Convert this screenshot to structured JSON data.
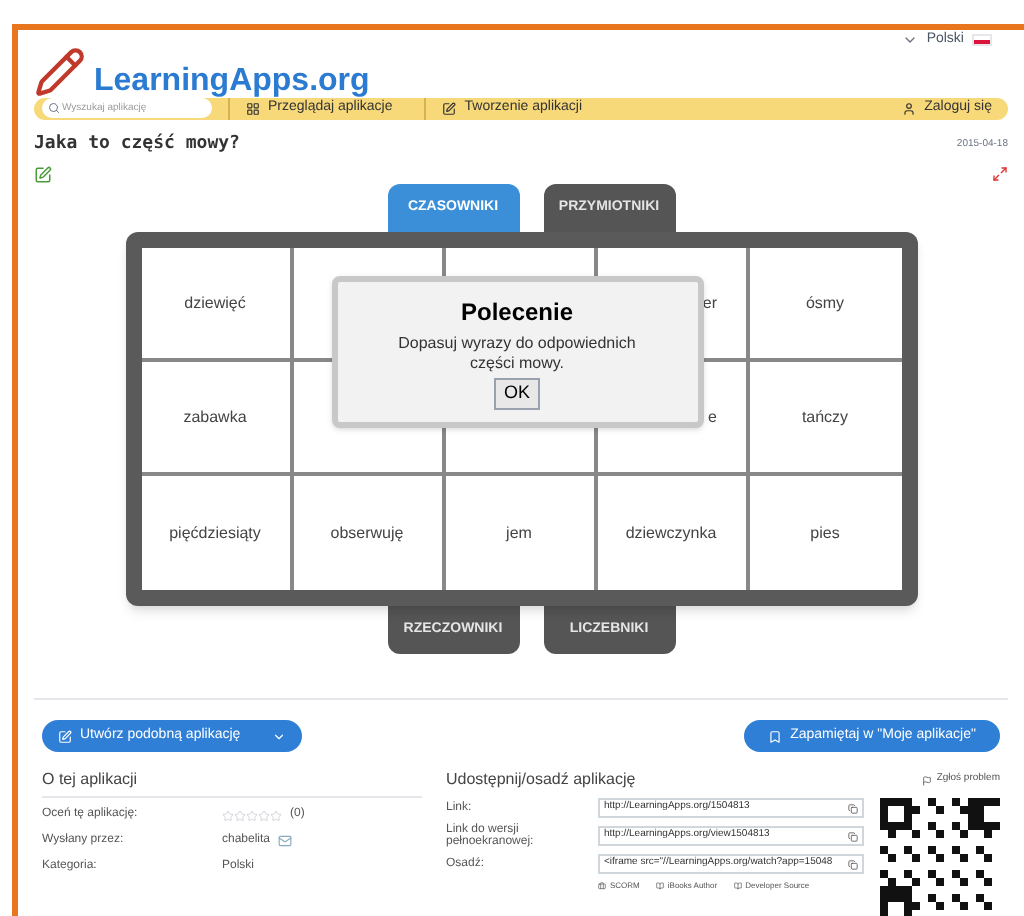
{
  "header": {
    "logo": "LearningApps.org",
    "language": "Polski"
  },
  "nav": {
    "search": {
      "placeholder": "Wyszukaj aplikację"
    },
    "links": [
      "Przeglądaj aplikacje",
      "Tworzenie aplikacji"
    ],
    "login": "Zaloguj się"
  },
  "app": {
    "title": "Jaka to część mowy?",
    "date": "2015-04-18"
  },
  "top_tabs": [
    {
      "label": "CZASOWNIKI",
      "selected": true
    },
    {
      "label": "PRZYMIOTNIKI",
      "selected": false
    }
  ],
  "grid": [
    [
      {
        "kind": "word",
        "text": "dziewięć"
      },
      {
        "kind": "covered"
      },
      {
        "kind": "covered"
      },
      {
        "kind": "partial",
        "text": "er"
      },
      {
        "kind": "word",
        "text": "ósmy"
      }
    ],
    [
      {
        "kind": "word",
        "text": "zabawka"
      },
      {
        "kind": "covered"
      },
      {
        "kind": "covered"
      },
      {
        "kind": "partial",
        "text": "e"
      },
      {
        "kind": "word",
        "text": "tańczy"
      }
    ],
    [
      {
        "kind": "word",
        "text": "pięćdziesiąty"
      },
      {
        "kind": "word",
        "text": "obserwuję"
      },
      {
        "kind": "word",
        "text": "jem"
      },
      {
        "kind": "word",
        "text": "dziewczynka"
      },
      {
        "kind": "word",
        "text": "pies"
      }
    ]
  ],
  "bottom_tabs": [
    {
      "label": "RZECZOWNIKI",
      "selected": false
    },
    {
      "label": "LICZEBNIKI",
      "selected": false
    }
  ],
  "dialog": {
    "title": "Polecenie",
    "text": "Dopasuj wyrazy do odpowiednich części mowy.",
    "button": "OK"
  },
  "actions": {
    "create_similar": "Utwórz podobną aplikację",
    "save": "Zapamiętaj w \"Moje aplikacje\""
  },
  "about": {
    "heading": "O tej aplikacji",
    "rows": [
      {
        "label": "Oceń tę aplikację:",
        "kind": "rating",
        "stars": 0,
        "value": "(0)"
      },
      {
        "label": "Wysłany przez:",
        "kind": "user",
        "value": "chabelita"
      },
      {
        "label": "Kategoria:",
        "kind": "text",
        "value": "Polski"
      }
    ]
  },
  "share": {
    "heading": "Udostępnij/osadź aplikację",
    "report": "Zgłoś problem",
    "rows": [
      {
        "label": "Link:",
        "value": "http://LearningApps.org/1504813"
      },
      {
        "label": "Link do wersji pełnoekranowej:",
        "value": "http://LearningApps.org/view1504813"
      },
      {
        "label": "Osadź:",
        "value": "<iframe src=\"//LearningApps.org/watch?app=15048"
      }
    ],
    "exports": [
      "SCORM",
      "iBooks Author",
      "Developer Source"
    ]
  }
}
